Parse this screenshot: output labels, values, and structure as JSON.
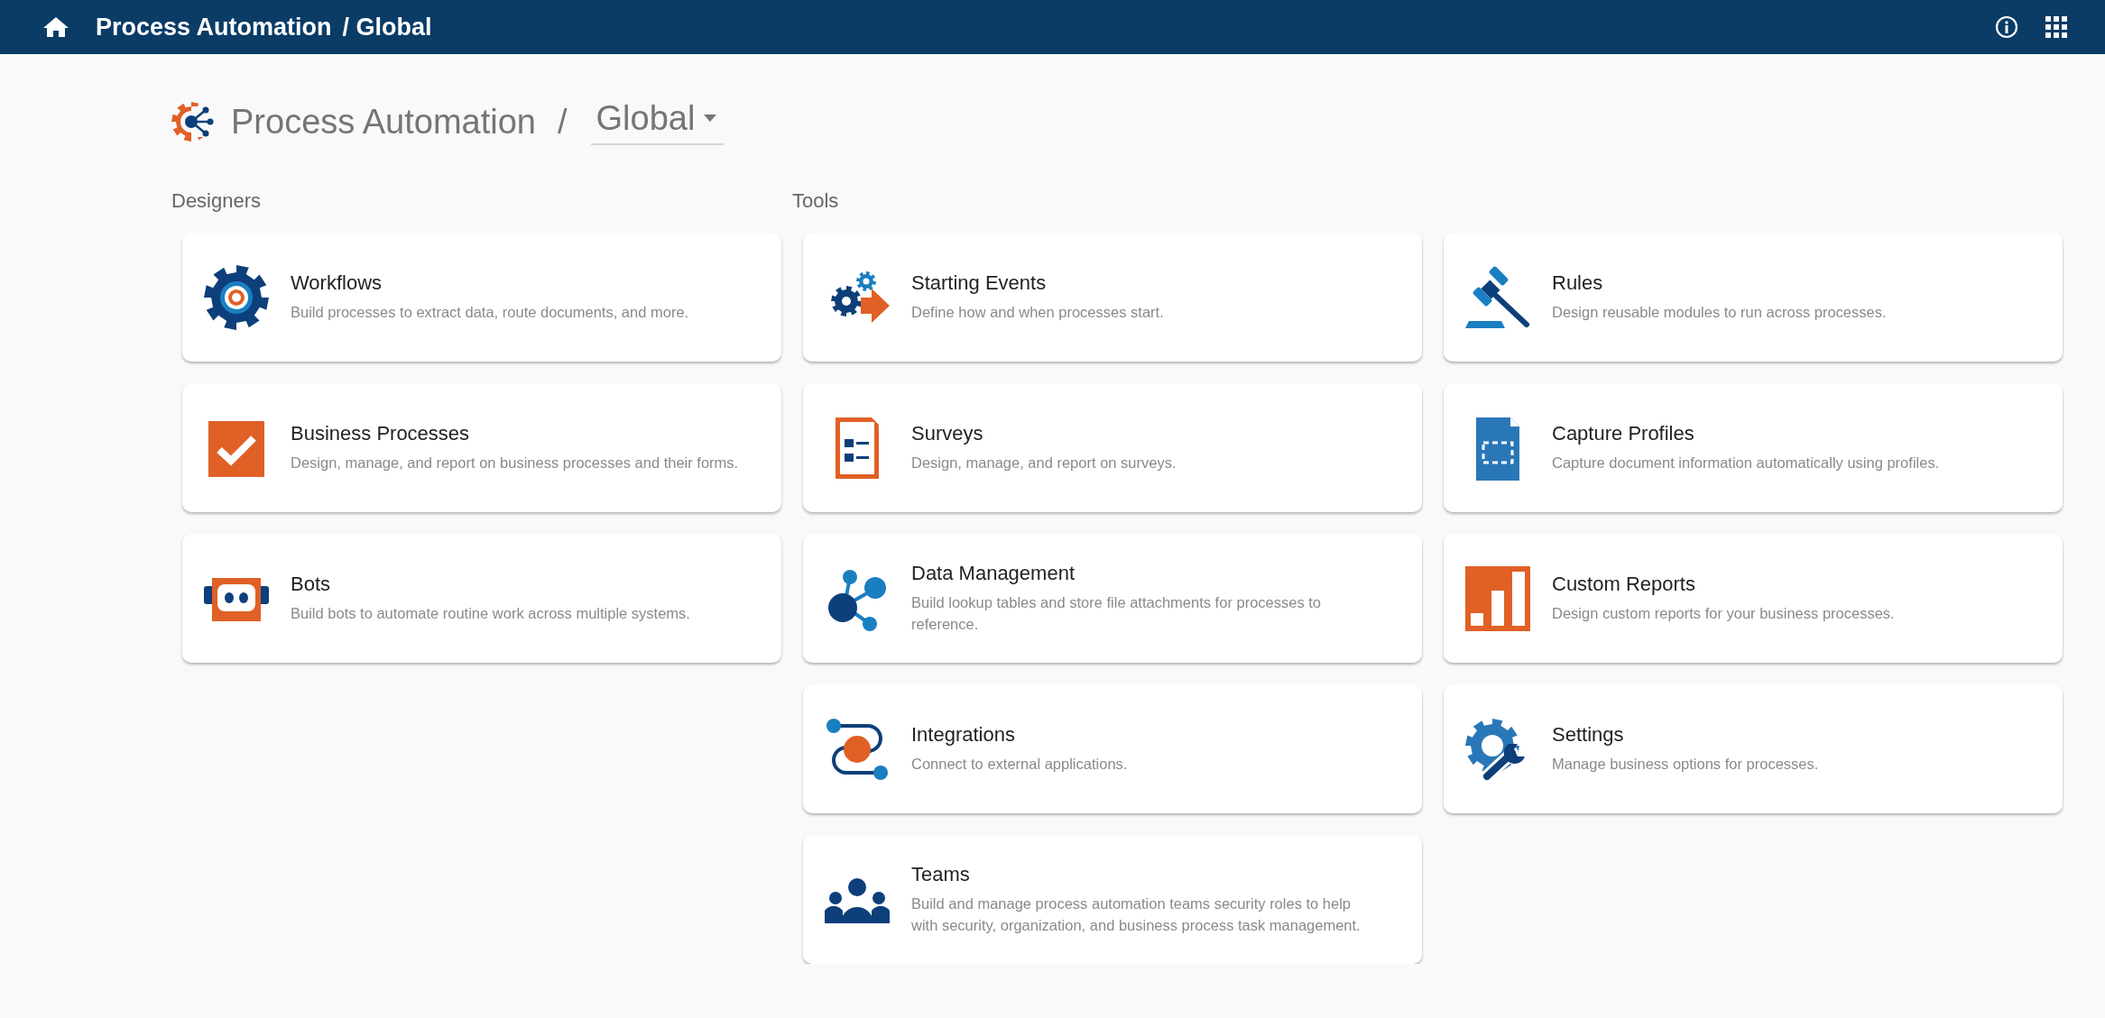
{
  "top_bar": {
    "title": "Process Automation",
    "scope": "/ Global"
  },
  "header": {
    "title": "Process Automation",
    "separator": "/",
    "scope_select": {
      "value": "Global"
    }
  },
  "sections": [
    {
      "label": "Designers",
      "cards": [
        {
          "title": "Workflows",
          "description": "Build processes to extract data, route documents, and more."
        },
        {
          "title": "Business Processes",
          "description": "Design, manage, and report on business processes and their forms."
        },
        {
          "title": "Bots",
          "description": "Build bots to automate routine work across multiple systems."
        }
      ]
    },
    {
      "label": "Tools",
      "cards": [
        {
          "title": "Starting Events",
          "description": "Define how and when processes start."
        },
        {
          "title": "Rules",
          "description": "Design reusable modules to run across processes."
        },
        {
          "title": "Surveys",
          "description": "Design, manage, and report on surveys."
        },
        {
          "title": "Capture Profiles",
          "description": "Capture document information automatically using profiles."
        },
        {
          "title": "Data Management",
          "description": "Build lookup tables and store file attachments for processes to reference."
        },
        {
          "title": "Custom Reports",
          "description": "Design custom reports for your business processes."
        },
        {
          "title": "Integrations",
          "description": "Connect to external applications."
        },
        {
          "title": "Settings",
          "description": "Manage business options for processes."
        },
        {
          "title": "Teams",
          "description": "Build and manage process automation teams security roles to help with security, organization, and business process task management."
        }
      ]
    }
  ]
}
